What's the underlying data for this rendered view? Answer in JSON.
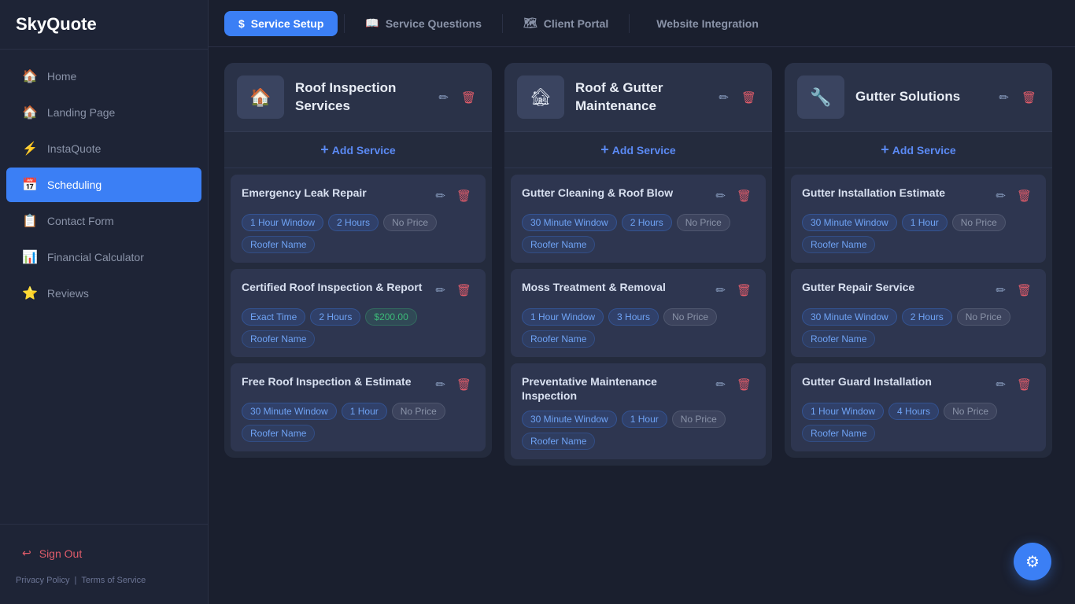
{
  "app": {
    "name": "SkyQuote"
  },
  "sidebar": {
    "items": [
      {
        "id": "home",
        "label": "Home",
        "icon": "🏠",
        "active": false
      },
      {
        "id": "landing-page",
        "label": "Landing Page",
        "icon": "🏠",
        "active": false
      },
      {
        "id": "instaquote",
        "label": "InstaQuote",
        "icon": "⚡",
        "active": false
      },
      {
        "id": "scheduling",
        "label": "Scheduling",
        "icon": "📅",
        "active": true
      },
      {
        "id": "contact-form",
        "label": "Contact Form",
        "icon": "📋",
        "active": false
      },
      {
        "id": "financial-calculator",
        "label": "Financial Calculator",
        "icon": "📊",
        "active": false
      },
      {
        "id": "reviews",
        "label": "Reviews",
        "icon": "⭐",
        "active": false
      }
    ],
    "sign_out_label": "Sign Out",
    "footer_links": [
      "Privacy Policy",
      "|",
      "Terms of Service"
    ]
  },
  "topnav": {
    "items": [
      {
        "id": "service-setup",
        "label": "Service Setup",
        "icon": "$",
        "active": true
      },
      {
        "id": "service-questions",
        "label": "Service Questions",
        "icon": "📖",
        "active": false
      },
      {
        "id": "client-portal",
        "label": "Client Portal",
        "icon": "🗺",
        "active": false
      },
      {
        "id": "website-integration",
        "label": "Website Integration",
        "icon": "</>",
        "active": false
      }
    ]
  },
  "categories": [
    {
      "id": "roof-inspection",
      "title": "Roof Inspection Services",
      "thumbnail_icon": "🏠",
      "add_service_label": "+ Add Service",
      "services": [
        {
          "name": "Emergency Leak Repair",
          "tags": [
            {
              "label": "1 Hour Window",
              "type": "window"
            },
            {
              "label": "2 Hours",
              "type": "hours"
            },
            {
              "label": "No Price",
              "type": "no-price"
            },
            {
              "label": "Roofer Name",
              "type": "roofer"
            }
          ]
        },
        {
          "name": "Certified Roof Inspection & Report",
          "tags": [
            {
              "label": "Exact Time",
              "type": "exact-time"
            },
            {
              "label": "2 Hours",
              "type": "hours"
            },
            {
              "label": "$200.00",
              "type": "price"
            },
            {
              "label": "Roofer Name",
              "type": "roofer"
            }
          ]
        },
        {
          "name": "Free Roof Inspection & Estimate",
          "tags": [
            {
              "label": "30 Minute Window",
              "type": "window"
            },
            {
              "label": "1 Hour",
              "type": "hours"
            },
            {
              "label": "No Price",
              "type": "no-price"
            },
            {
              "label": "Roofer Name",
              "type": "roofer"
            }
          ]
        }
      ]
    },
    {
      "id": "roof-gutter-maintenance",
      "title": "Roof & Gutter Maintenance",
      "thumbnail_icon": "🏚",
      "add_service_label": "+ Add Service",
      "services": [
        {
          "name": "Gutter Cleaning & Roof Blow",
          "tags": [
            {
              "label": "30 Minute Window",
              "type": "window"
            },
            {
              "label": "2 Hours",
              "type": "hours"
            },
            {
              "label": "No Price",
              "type": "no-price"
            },
            {
              "label": "Roofer Name",
              "type": "roofer"
            }
          ]
        },
        {
          "name": "Moss Treatment & Removal",
          "tags": [
            {
              "label": "1 Hour Window",
              "type": "window"
            },
            {
              "label": "3 Hours",
              "type": "hours"
            },
            {
              "label": "No Price",
              "type": "no-price"
            },
            {
              "label": "Roofer Name",
              "type": "roofer"
            }
          ]
        },
        {
          "name": "Preventative Maintenance Inspection",
          "tags": [
            {
              "label": "30 Minute Window",
              "type": "window"
            },
            {
              "label": "1 Hour",
              "type": "hours"
            },
            {
              "label": "No Price",
              "type": "no-price"
            },
            {
              "label": "Roofer Name",
              "type": "roofer"
            }
          ]
        }
      ]
    },
    {
      "id": "gutter-solutions",
      "title": "Gutter Solutions",
      "thumbnail_icon": "🔧",
      "add_service_label": "+ Add Service",
      "services": [
        {
          "name": "Gutter Installation Estimate",
          "tags": [
            {
              "label": "30 Minute Window",
              "type": "window"
            },
            {
              "label": "1 Hour",
              "type": "hours"
            },
            {
              "label": "No Price",
              "type": "no-price"
            },
            {
              "label": "Roofer Name",
              "type": "roofer"
            }
          ]
        },
        {
          "name": "Gutter Repair Service",
          "tags": [
            {
              "label": "30 Minute Window",
              "type": "window"
            },
            {
              "label": "2 Hours",
              "type": "hours"
            },
            {
              "label": "No Price",
              "type": "no-price"
            },
            {
              "label": "Roofer Name",
              "type": "roofer"
            }
          ]
        },
        {
          "name": "Gutter Guard Installation",
          "tags": [
            {
              "label": "1 Hour Window",
              "type": "window"
            },
            {
              "label": "4 Hours",
              "type": "hours"
            },
            {
              "label": "No Price",
              "type": "no-price"
            },
            {
              "label": "Roofer Name",
              "type": "roofer"
            }
          ]
        }
      ]
    }
  ],
  "fab": {
    "icon": "⚙"
  }
}
